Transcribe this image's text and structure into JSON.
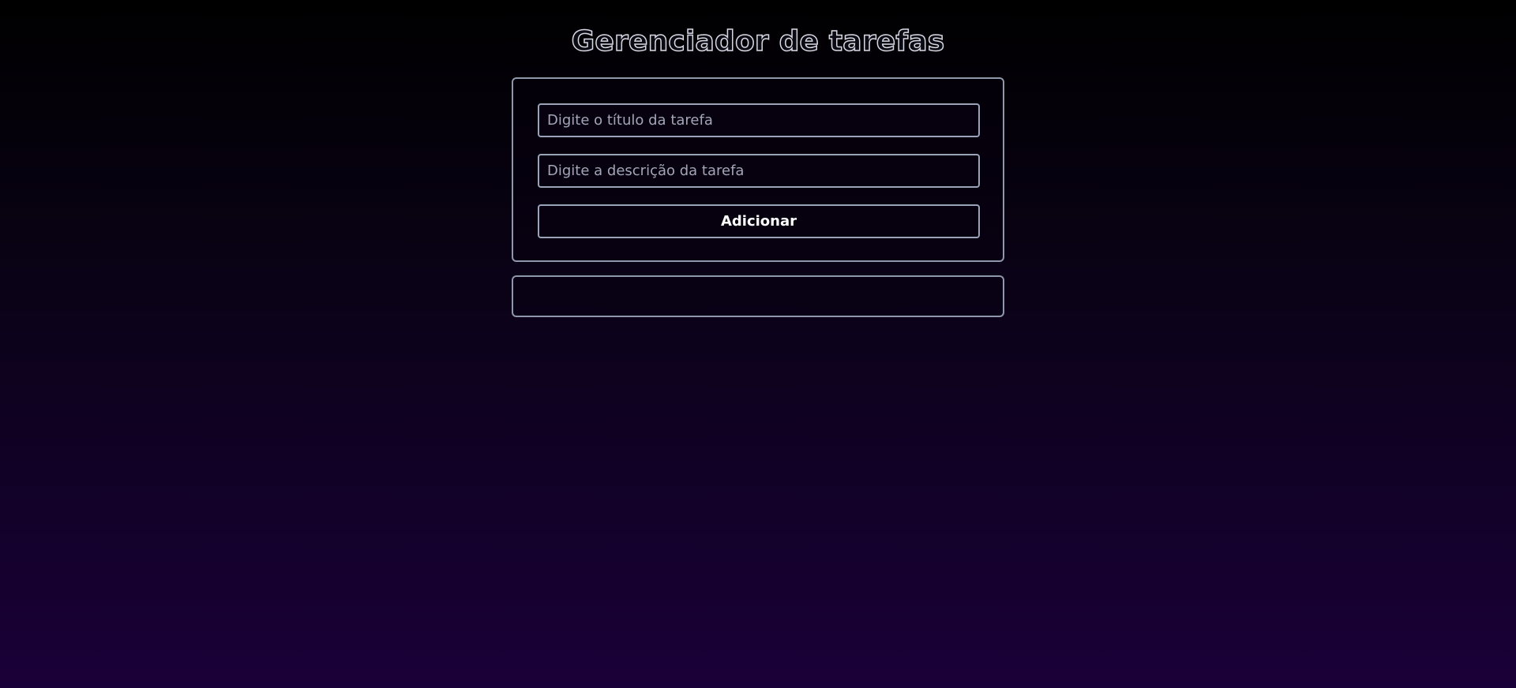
{
  "app": {
    "title": "Gerenciador de tarefas"
  },
  "form": {
    "title_input": {
      "value": "",
      "placeholder": "Digite o título da tarefa"
    },
    "description_input": {
      "value": "",
      "placeholder": "Digite a descrição da tarefa"
    },
    "add_button_label": "Adicionar"
  },
  "task_list": {
    "items": []
  },
  "colors": {
    "background_top": "#000000",
    "background_bottom": "#1a0038",
    "border": "#8f97ad",
    "text": "#ffffff",
    "placeholder": "#a3a6b8"
  }
}
